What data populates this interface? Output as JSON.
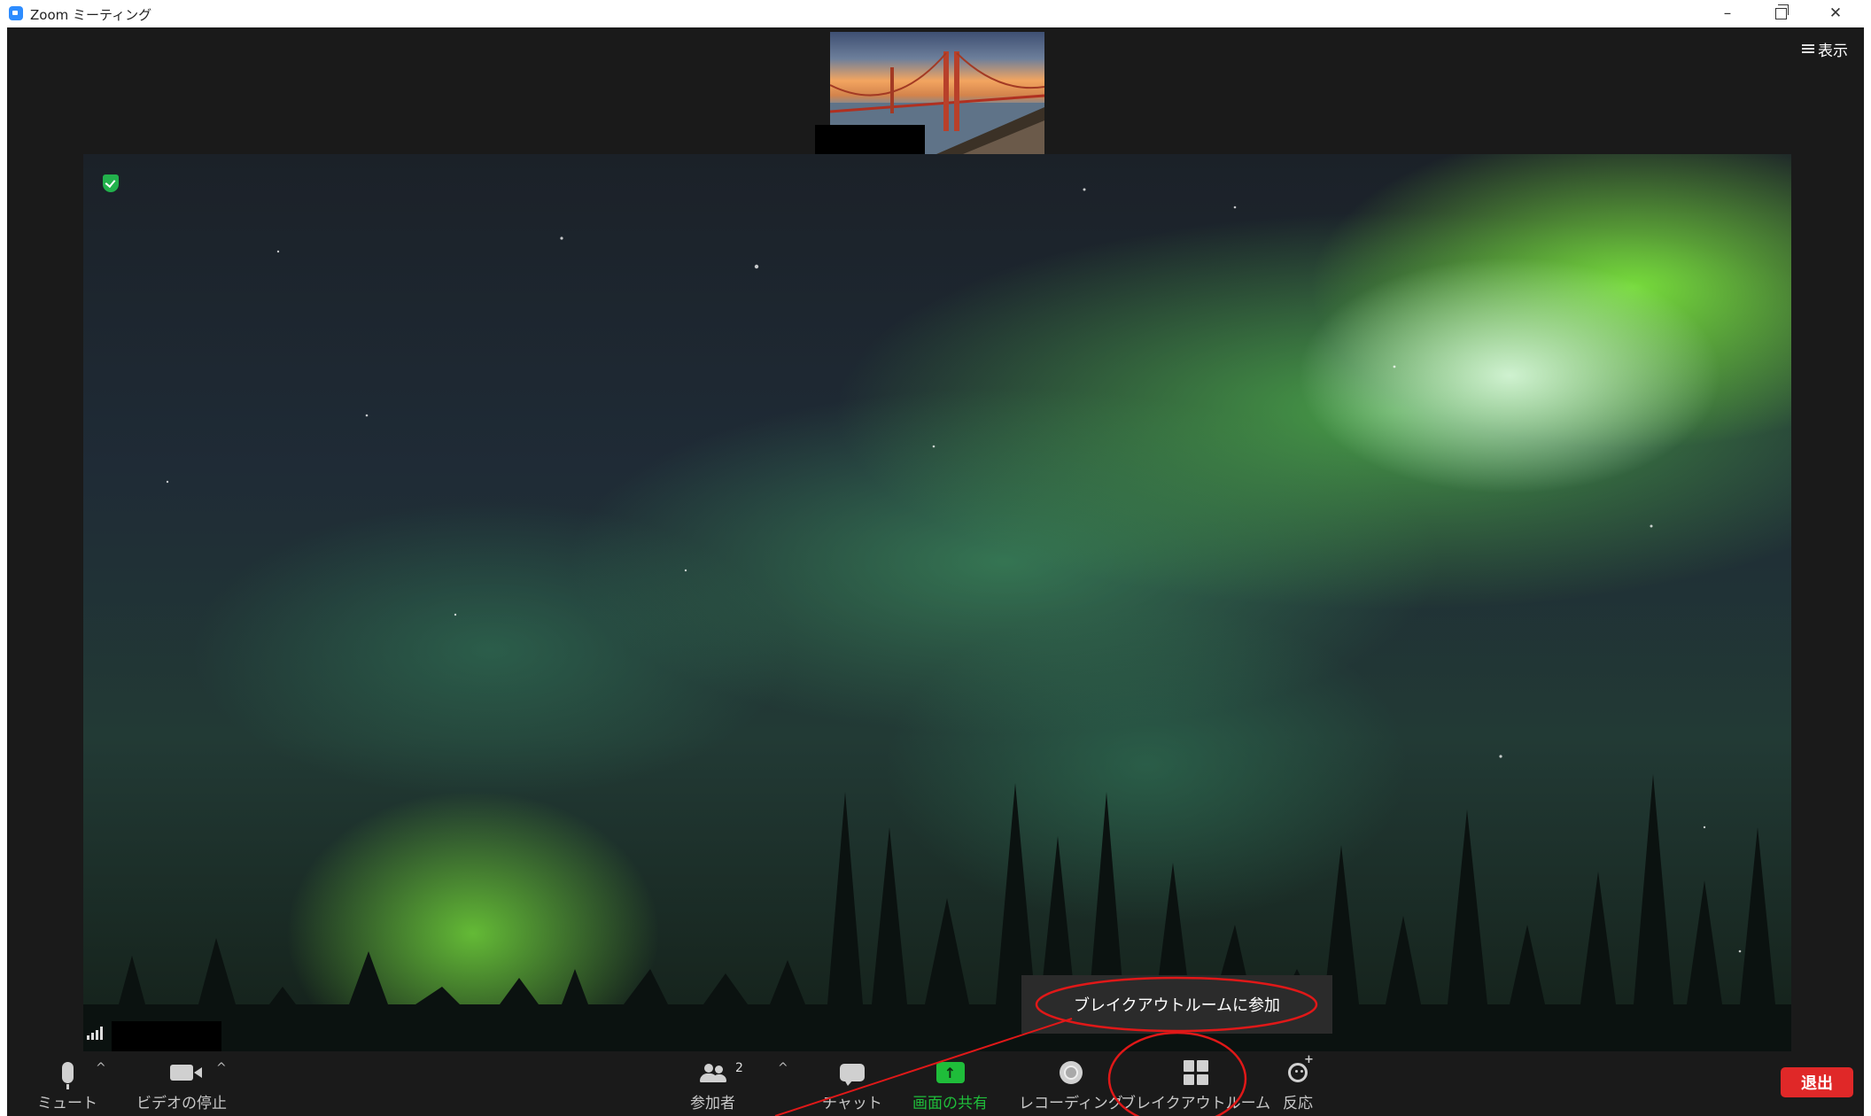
{
  "window": {
    "title": "Zoom ミーティング",
    "minimize": "–",
    "close": "✕"
  },
  "header": {
    "view_label": "表示"
  },
  "toolbar": {
    "mute_label": "ミュート",
    "video_label": "ビデオの停止",
    "participants_label": "参加者",
    "participants_count": "2",
    "chat_label": "チャット",
    "share_label": "画面の共有",
    "record_label": "レコーディング",
    "breakout_label": "ブレイクアウトルーム",
    "reactions_label": "反応",
    "end_label": "退出",
    "share_arrow": "↑",
    "caret": "^"
  },
  "popup": {
    "join_breakout_label": "ブレイクアウトルームに参加"
  },
  "icons": {
    "app": "zoom-logo-icon",
    "secure": "shield-icon",
    "signal": "signal-icon",
    "mute": "microphone-icon",
    "video": "camera-icon",
    "participants": "people-icon",
    "chat": "chat-bubble-icon",
    "share": "share-screen-icon",
    "record": "record-icon",
    "breakout": "grid-icon",
    "reactions": "emoji-plus-icon"
  },
  "colors": {
    "accent": "#2d8cff",
    "share_green": "#1fbd3a",
    "end_red": "#e02828",
    "annotation_red": "#e01818",
    "secure_green": "#22b14c"
  }
}
